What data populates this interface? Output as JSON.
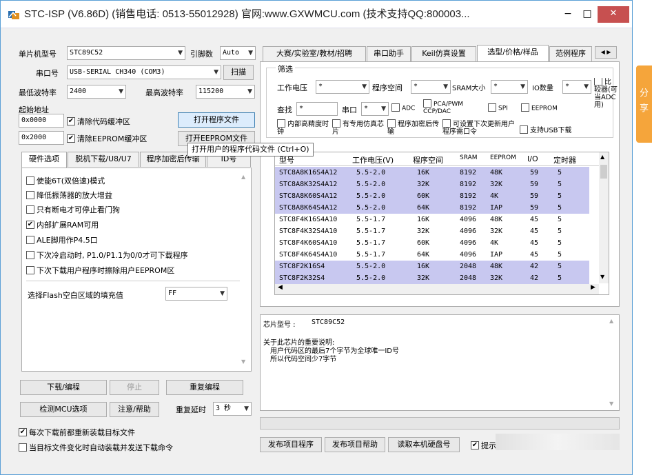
{
  "window": {
    "title": "STC-ISP (V6.86D) (销售电话: 0513-55012928) 官网:www.GXWMCU.com  (技术支持QQ:800003...",
    "min": "−",
    "max": "□",
    "close": "✕"
  },
  "left": {
    "mcu_label": "单片机型号",
    "mcu_value": "STC89C52",
    "pins_label": "引脚数",
    "pins_value": "Auto",
    "port_label": "串口号",
    "port_value": "USB-SERIAL CH340 (COM3)",
    "scan_label": "扫描",
    "min_baud_label": "最低波特率",
    "min_baud_value": "2400",
    "max_baud_label": "最高波特率",
    "max_baud_value": "115200",
    "start_addr_label": "起始地址",
    "addr1_value": "0x0000",
    "clear_code_label": "清除代码缓冲区",
    "open_prog_label": "打开程序文件",
    "addr2_value": "0x2000",
    "clear_eeprom_label": "清除EEPROM缓冲区",
    "open_eeprom_label": "打开EEPROM文件",
    "tooltip": "打开用户的程序代码文件 (Ctrl+O)",
    "tabs": [
      "硬件选项",
      "脱机下载/U8/U7",
      "程序加密后传输",
      "ID号"
    ],
    "options": [
      {
        "label": "使能6T(双倍速)模式",
        "checked": false
      },
      {
        "label": "降低振荡器的放大增益",
        "checked": false
      },
      {
        "label": "只有断电才可停止看门狗",
        "checked": false
      },
      {
        "label": "内部扩展RAM可用",
        "checked": true
      },
      {
        "label": "ALE脚用作P4.5口",
        "checked": false
      },
      {
        "label": "下次冷启动时, P1.0/P1.1为0/0才可下载程序",
        "checked": false
      },
      {
        "label": "下次下载用户程序时擦除用户EEPROM区",
        "checked": false
      }
    ],
    "fill_label": "选择Flash空白区域的填充值",
    "fill_value": "FF",
    "download_label": "下载/编程",
    "stop_label": "停止",
    "reprogram_label": "重复编程",
    "detect_label": "检测MCU选项",
    "help_label": "注意/帮助",
    "delay_label": "重复延时",
    "delay_value": "3 秒",
    "reload_label": "每次下载前都重新装载目标文件",
    "reload_checked": true,
    "autoload_label": "当目标文件变化时自动装载并发送下载命令",
    "autoload_checked": false
  },
  "right": {
    "tabs": [
      "大赛/实验室/教材/招聘",
      "串口助手",
      "Keil仿真设置",
      "选型/价格/样品",
      "范例程序"
    ],
    "filter_title": "筛选",
    "voltage_label": "工作电压",
    "voltage_value": "*",
    "progspace_label": "程序空间",
    "progspace_value": "*",
    "sram_label": "SRAM大小",
    "sram_value": "*",
    "io_label": "IO数量",
    "io_value": "*",
    "comparator_label": "比较器(可当ADC用)",
    "search_label": "查找",
    "search_value": "*",
    "uart_label": "串口",
    "uart_value": "*",
    "adc_label": "ADC",
    "pca_label": "PCA/PWM CCP/DAC",
    "spi_label": "SPI",
    "eeprom_label": "EEPROM",
    "rtc_label": "内部高精度时钟",
    "sim_label": "有专用仿真芯片",
    "encrypt_label": "程序加密后传输",
    "nextupd_label": "可设置下次更新用户程序需口令",
    "usb_label": "支持USB下载",
    "columns": [
      "型号",
      "工作电压(V)",
      "程序空间",
      "SRAM",
      "EEPROM",
      "I/O",
      "定时器"
    ],
    "rows": [
      {
        "model": "STC8A8K16S4A12",
        "v": "5.5-2.0",
        "prog": "16K",
        "sram": "8192",
        "eeprom": "48K",
        "io": "59",
        "timer": "5",
        "sel": true
      },
      {
        "model": "STC8A8K32S4A12",
        "v": "5.5-2.0",
        "prog": "32K",
        "sram": "8192",
        "eeprom": "32K",
        "io": "59",
        "timer": "5",
        "sel": true
      },
      {
        "model": "STC8A8K60S4A12",
        "v": "5.5-2.0",
        "prog": "60K",
        "sram": "8192",
        "eeprom": "4K",
        "io": "59",
        "timer": "5",
        "sel": true
      },
      {
        "model": "STC8A8K64S4A12",
        "v": "5.5-2.0",
        "prog": "64K",
        "sram": "8192",
        "eeprom": "IAP",
        "io": "59",
        "timer": "5",
        "sel": true
      },
      {
        "model": "STC8F4K16S4A10",
        "v": "5.5-1.7",
        "prog": "16K",
        "sram": "4096",
        "eeprom": "48K",
        "io": "45",
        "timer": "5",
        "sel": false
      },
      {
        "model": "STC8F4K32S4A10",
        "v": "5.5-1.7",
        "prog": "32K",
        "sram": "4096",
        "eeprom": "32K",
        "io": "45",
        "timer": "5",
        "sel": false
      },
      {
        "model": "STC8F4K60S4A10",
        "v": "5.5-1.7",
        "prog": "60K",
        "sram": "4096",
        "eeprom": "4K",
        "io": "45",
        "timer": "5",
        "sel": false
      },
      {
        "model": "STC8F4K64S4A10",
        "v": "5.5-1.7",
        "prog": "64K",
        "sram": "4096",
        "eeprom": "IAP",
        "io": "45",
        "timer": "5",
        "sel": false
      },
      {
        "model": "STC8F2K16S4",
        "v": "5.5-2.0",
        "prog": "16K",
        "sram": "2048",
        "eeprom": "48K",
        "io": "42",
        "timer": "5",
        "sel": true
      },
      {
        "model": "STC8F2K32S4",
        "v": "5.5-2.0",
        "prog": "32K",
        "sram": "2048",
        "eeprom": "32K",
        "io": "42",
        "timer": "5",
        "sel": true
      }
    ],
    "chip_label": "芯片型号 : ",
    "chip_value": "STC89C52",
    "notes_title": "关于此芯片的重要说明:",
    "note1": "用户代码区的最后7个字节为全球唯一ID号",
    "note2": "所以代码空间少7字节",
    "publish_prog": "发布项目程序",
    "publish_help": "发布项目帮助",
    "read_disk": "读取本机硬盘号",
    "hint_label": "提示"
  },
  "sidebar": {
    "text1": "分",
    "text2": "享"
  }
}
